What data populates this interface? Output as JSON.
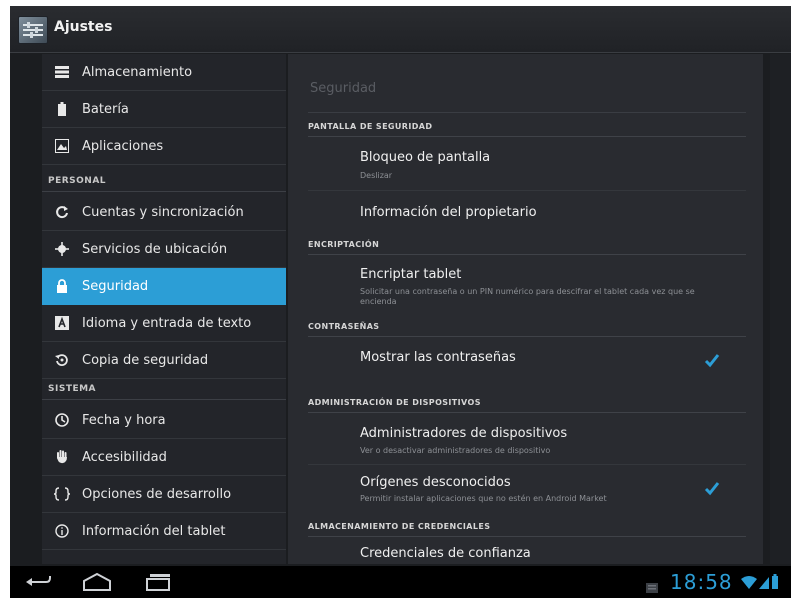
{
  "app": {
    "title": "Ajustes"
  },
  "sidebar": {
    "items_top": [
      {
        "label": "Almacenamiento",
        "icon": "storage-icon"
      },
      {
        "label": "Batería",
        "icon": "battery-icon"
      },
      {
        "label": "Aplicaciones",
        "icon": "apps-icon"
      }
    ],
    "header_personal": "PERSONAL",
    "items_personal": [
      {
        "label": "Cuentas y sincronización",
        "icon": "sync-icon"
      },
      {
        "label": "Servicios de ubicación",
        "icon": "location-icon"
      },
      {
        "label": "Seguridad",
        "icon": "lock-icon",
        "selected": true
      },
      {
        "label": "Idioma y entrada de texto",
        "icon": "language-icon"
      },
      {
        "label": "Copia de seguridad",
        "icon": "backup-icon"
      }
    ],
    "header_sistema": "SISTEMA",
    "items_sistema": [
      {
        "label": "Fecha y hora",
        "icon": "clock-icon"
      },
      {
        "label": "Accesibilidad",
        "icon": "hand-icon"
      },
      {
        "label": "Opciones de desarrollo",
        "icon": "braces-icon"
      },
      {
        "label": "Información del tablet",
        "icon": "info-icon"
      }
    ]
  },
  "content": {
    "title": "Seguridad",
    "sections": [
      {
        "header": "PANTALLA DE SEGURIDAD",
        "rows": [
          {
            "title": "Bloqueo de pantalla",
            "subtitle": "Deslizar"
          },
          {
            "title": "Información del propietario"
          }
        ]
      },
      {
        "header": "ENCRIPTACIÓN",
        "rows": [
          {
            "title": "Encriptar tablet",
            "subtitle": "Solicitar una contraseña o un PIN numérico para descifrar el tablet cada vez que se encienda"
          }
        ]
      },
      {
        "header": "CONTRASEÑAS",
        "rows": [
          {
            "title": "Mostrar las contraseñas",
            "checked": true
          }
        ]
      },
      {
        "header": "ADMINISTRACIÓN DE DISPOSITIVOS",
        "rows": [
          {
            "title": "Administradores de dispositivos",
            "subtitle": "Ver o desactivar administradores de dispositivo"
          },
          {
            "title": "Orígenes desconocidos",
            "subtitle": "Permitir instalar aplicaciones que no estén en Android Market",
            "checked": true
          }
        ]
      },
      {
        "header": "ALMACENAMIENTO DE CREDENCIALES",
        "rows": [
          {
            "title": "Credenciales de confianza"
          }
        ]
      }
    ]
  },
  "status_bar": {
    "time": "18:58"
  },
  "colors": {
    "accent": "#2c9ed6",
    "background": "#1b1d20"
  }
}
